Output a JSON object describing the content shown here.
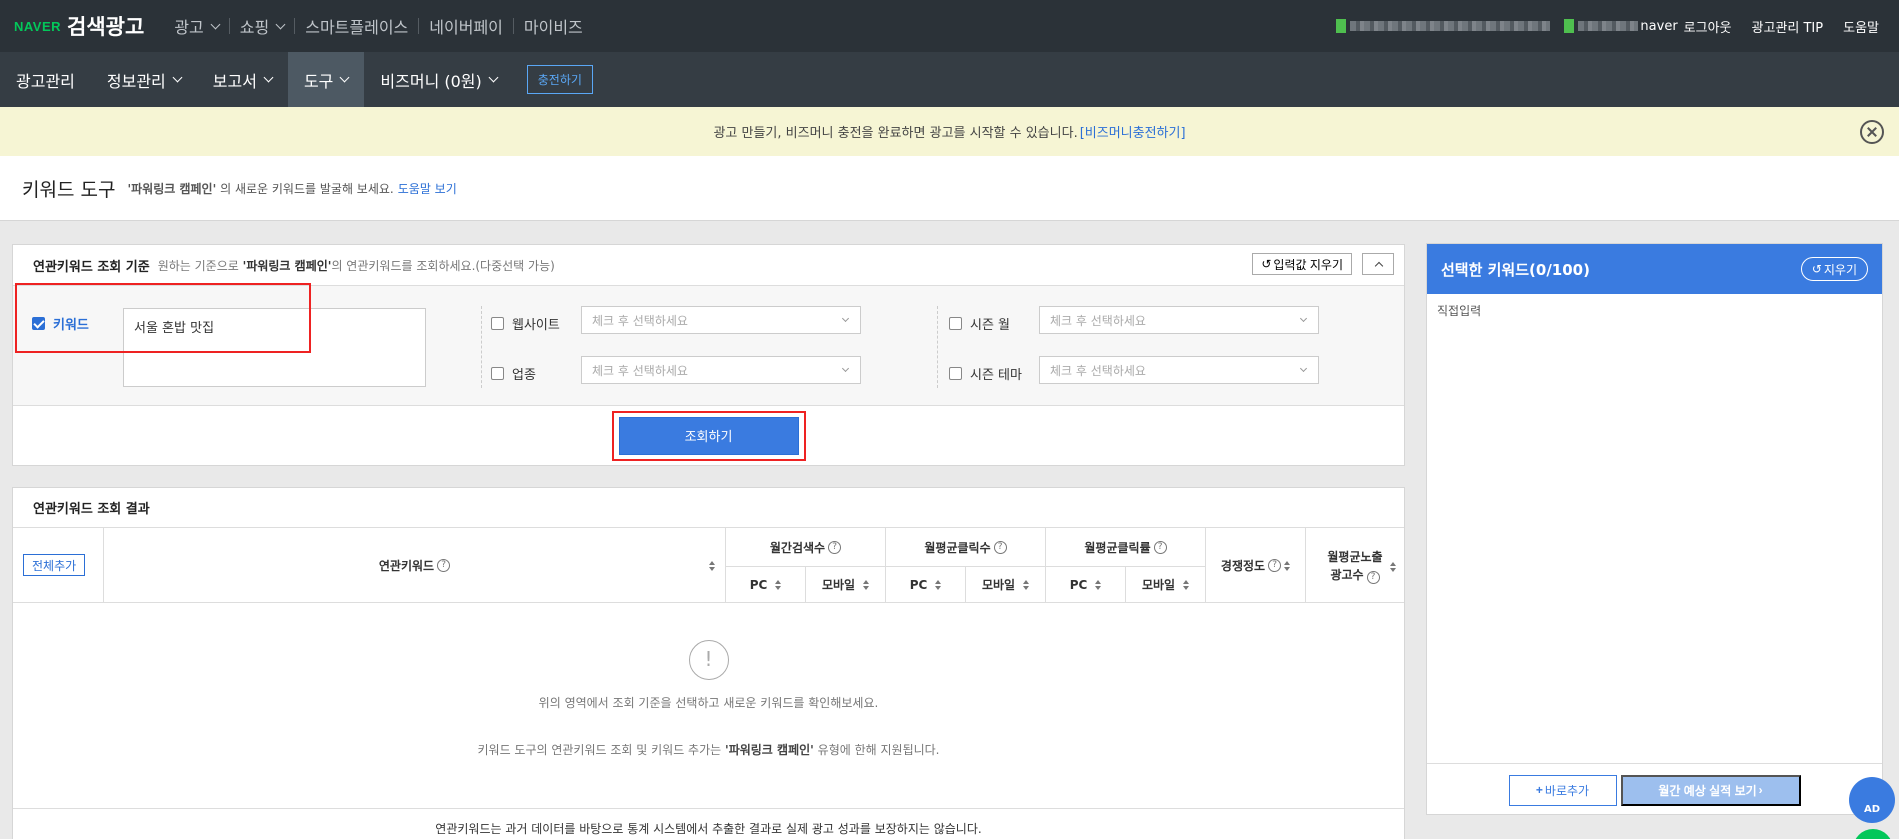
{
  "topbar": {
    "logo_naver": "NAVER",
    "logo_title": "검색광고",
    "nav": [
      "광고",
      "쇼핑",
      "스마트플레이스",
      "네이버페이",
      "마이비즈"
    ],
    "user_suffix": "naver",
    "logout": "로그아웃",
    "tip": "광고관리 TIP",
    "help": "도움말"
  },
  "subnav": {
    "items": [
      "광고관리",
      "정보관리",
      "보고서",
      "도구",
      "비즈머니 (0원)"
    ],
    "charge": "충전하기"
  },
  "notice": {
    "text": "광고 만들기, 비즈머니 충전을 완료하면 광고를 시작할 수 있습니다.",
    "link": "[비즈머니충전하기]"
  },
  "page": {
    "title": "키워드 도구",
    "desc_quote": "'파워링크 캠페인'",
    "desc_rest": "의 새로운 키워드를 발굴해 보세요.",
    "help_link": "도움말 보기"
  },
  "criteria": {
    "title": "연관키워드 조회 기준",
    "sub_pre": "원하는 기준으로",
    "sub_quote": "'파워링크 캠페인'",
    "sub_post": "의 연관키워드를 조회하세요.(다중선택 가능)",
    "clear": "입력값 지우기",
    "keyword_label": "키워드",
    "keyword_value": "서울 혼밥 맛집",
    "website_label": "웹사이트",
    "industry_label": "업종",
    "season_month_label": "시즌 월",
    "season_theme_label": "시즌 테마",
    "select_placeholder": "체크 후 선택하세요",
    "search": "조회하기"
  },
  "results": {
    "title": "연관키워드 조회 결과",
    "add_all": "전체추가",
    "col_keyword": "연관키워드",
    "col_search": "월간검색수",
    "col_clicks": "월평균클릭수",
    "col_ctr": "월평균클릭률",
    "col_comp": "경쟁정도",
    "col_ads_1": "월평균노출",
    "col_ads_2": "광고수",
    "pc": "PC",
    "mobile": "모바일",
    "empty_1": "위의 영역에서 조회 기준을 선택하고 새로운 키워드를 확인해보세요.",
    "empty_2_pre": "키워드 도구의 연관키워드 조회 및 키워드 추가는",
    "empty_2_quote": "'파워링크 캠페인'",
    "empty_2_post": "유형에 한해 지원됩니다.",
    "footnote": "연관키워드는 과거 데이터를 바탕으로 통계 시스템에서 추출한 결과로 실제 광고 성과를 보장하지는 않습니다."
  },
  "selected": {
    "title": "선택한 키워드(0/100)",
    "clear": "지우기",
    "direct_input": "직접입력",
    "quick_add": "바로추가",
    "forecast": "월간 예상 실적 보기"
  },
  "badge": {
    "ad": "AD"
  },
  "colors": {
    "accent": "#3a7be0",
    "naver_green": "#03c75a",
    "highlight_red": "#e22222"
  }
}
